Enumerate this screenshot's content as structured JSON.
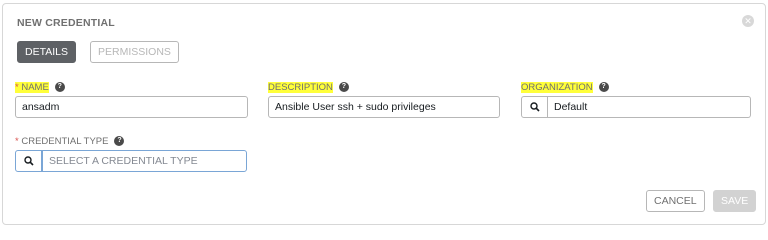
{
  "header": {
    "title": "NEW CREDENTIAL",
    "close_symbol": "✕"
  },
  "tabs": [
    {
      "label": "DETAILS",
      "active": true
    },
    {
      "label": "PERMISSIONS",
      "active": false
    }
  ],
  "fields": {
    "name": {
      "required_mark": "*",
      "label": "NAME",
      "value": "ansadm",
      "highlighted": true
    },
    "description": {
      "label": "DESCRIPTION",
      "value": "Ansible User ssh + sudo privileges",
      "highlighted": true
    },
    "organization": {
      "label": "ORGANIZATION",
      "value": "Default",
      "highlighted": true
    },
    "credential_type": {
      "required_mark": "*",
      "label": "CREDENTIAL TYPE",
      "placeholder": "SELECT A CREDENTIAL TYPE"
    }
  },
  "help_symbol": "?",
  "buttons": {
    "cancel": "CANCEL",
    "save": "SAVE"
  },
  "colors": {
    "highlight": "#ffff3a",
    "active_tab": "#5e6165",
    "required": "#d9534f",
    "focus_border": "#7aa6d6"
  },
  "icons": {
    "lookup": "search-icon",
    "help": "question-circle-icon",
    "close": "close-icon"
  }
}
